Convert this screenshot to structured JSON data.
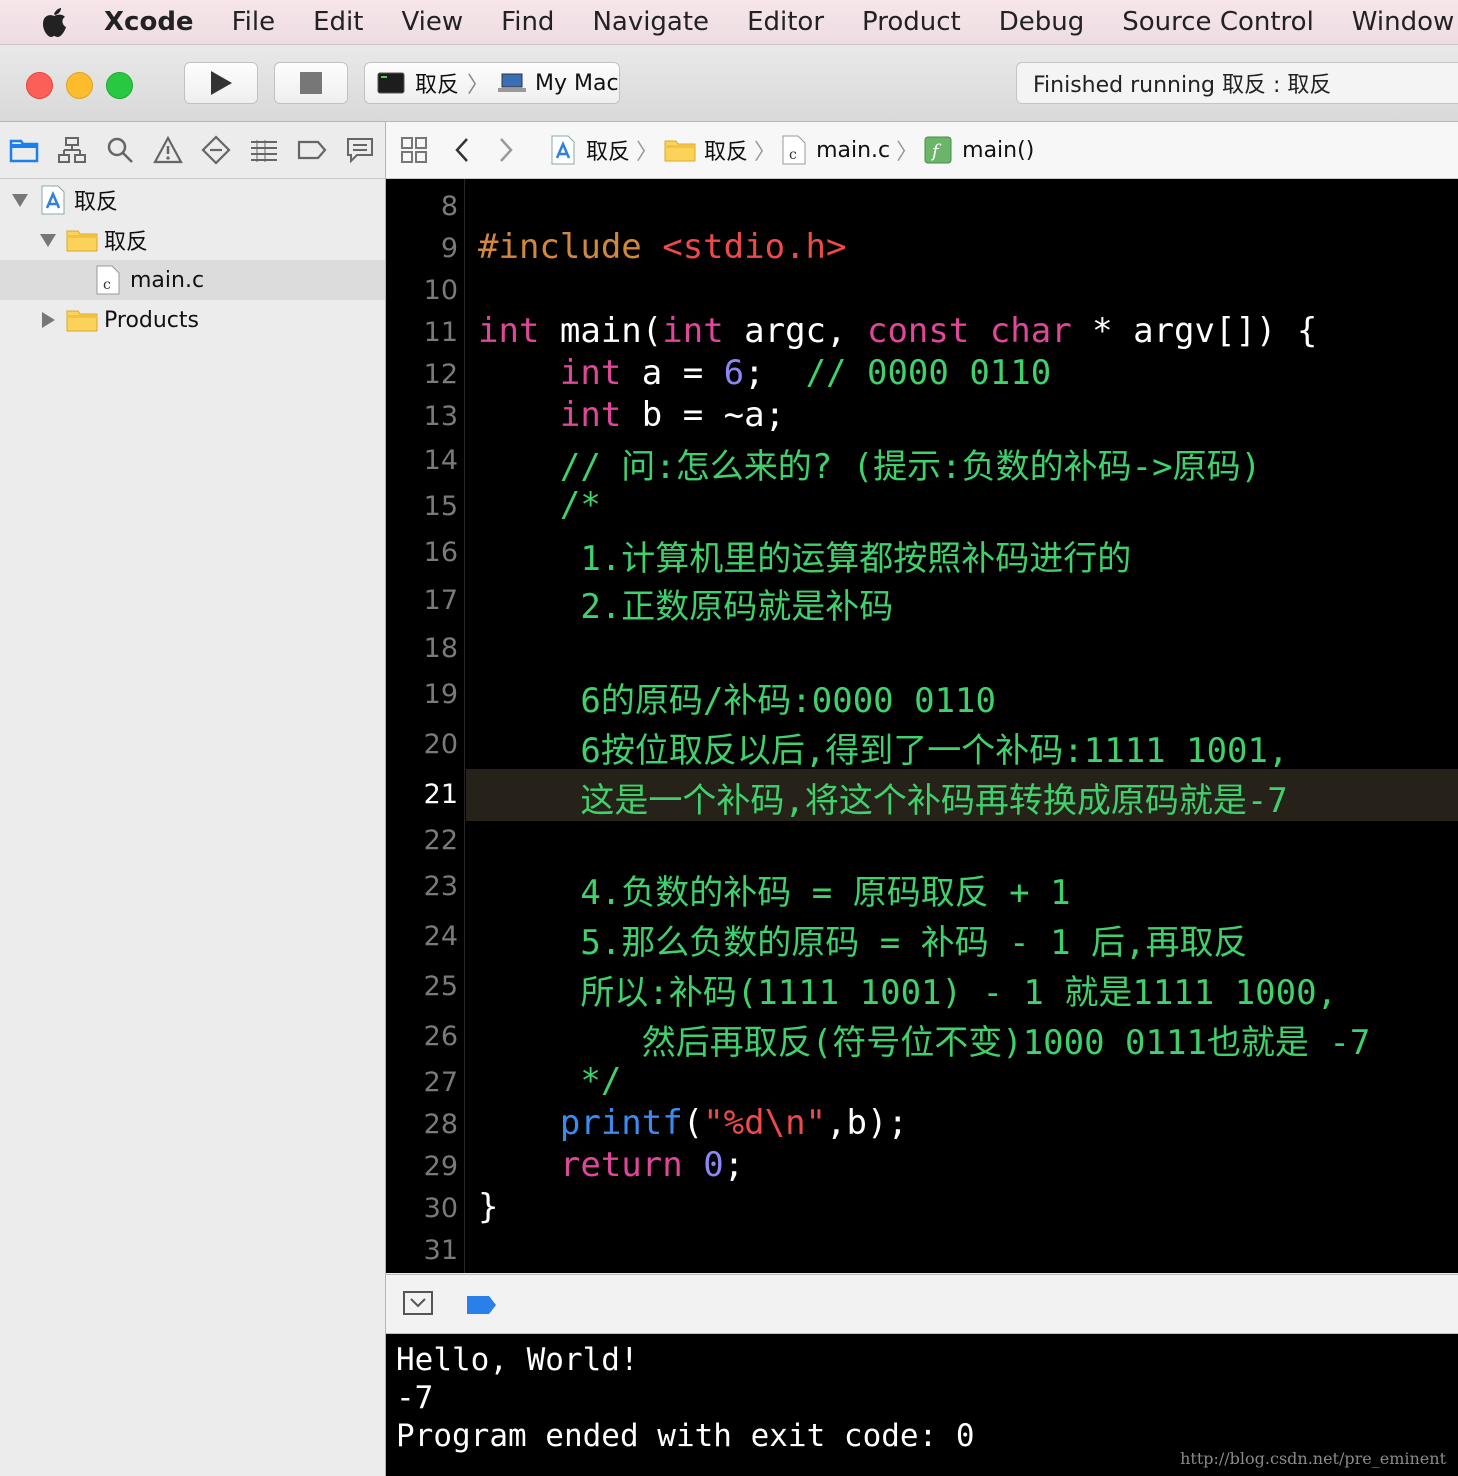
{
  "menubar": {
    "app": "Xcode",
    "items": [
      "File",
      "Edit",
      "View",
      "Find",
      "Navigate",
      "Editor",
      "Product",
      "Debug",
      "Source Control",
      "Window"
    ]
  },
  "toolbar": {
    "scheme": "取反",
    "destination": "My Mac",
    "status": "Finished running 取反 : 取反"
  },
  "navigator": {
    "items": [
      {
        "label": "取反",
        "indent": 0,
        "disclosure": "open",
        "icon": "project-icon"
      },
      {
        "label": "取反",
        "indent": 1,
        "disclosure": "open",
        "icon": "folder-icon"
      },
      {
        "label": "main.c",
        "indent": 2,
        "disclosure": "none",
        "icon": "c-file-icon",
        "selected": true
      },
      {
        "label": "Products",
        "indent": 1,
        "disclosure": "closed",
        "icon": "folder-icon"
      }
    ]
  },
  "jumpbar": {
    "crumbs": [
      {
        "label": "取反",
        "icon": "project-icon"
      },
      {
        "label": "取反",
        "icon": "folder-icon"
      },
      {
        "label": "main.c",
        "icon": "c-file-icon"
      },
      {
        "label": "main()",
        "icon": "function-icon"
      }
    ]
  },
  "editor": {
    "current_line": 21,
    "lines": [
      {
        "n": 8,
        "tokens": []
      },
      {
        "n": 9,
        "tokens": [
          [
            "pp",
            "#include "
          ],
          [
            "str",
            "<stdio.h>"
          ]
        ]
      },
      {
        "n": 10,
        "tokens": []
      },
      {
        "n": 11,
        "tokens": [
          [
            "kw",
            "int"
          ],
          [
            "pl",
            " main("
          ],
          [
            "kw",
            "int"
          ],
          [
            "pl",
            " argc, "
          ],
          [
            "kw",
            "const"
          ],
          [
            "pl",
            " "
          ],
          [
            "kw",
            "char"
          ],
          [
            "pl",
            " * argv[]) {"
          ]
        ]
      },
      {
        "n": 12,
        "tokens": [
          [
            "pl",
            "    "
          ],
          [
            "kw",
            "int"
          ],
          [
            "pl",
            " a = "
          ],
          [
            "num",
            "6"
          ],
          [
            "pl",
            ";  "
          ],
          [
            "cm",
            "// 0000 0110"
          ]
        ]
      },
      {
        "n": 13,
        "tokens": [
          [
            "pl",
            "    "
          ],
          [
            "kw",
            "int"
          ],
          [
            "pl",
            " b = ~a;"
          ]
        ]
      },
      {
        "n": 14,
        "tokens": [
          [
            "pl",
            "    "
          ],
          [
            "cm",
            "// 问:怎么来的? (提示:负数的补码->原码)"
          ]
        ]
      },
      {
        "n": 15,
        "tokens": [
          [
            "pl",
            "    "
          ],
          [
            "cm",
            "/*"
          ]
        ]
      },
      {
        "n": 16,
        "tokens": [
          [
            "pl",
            "     "
          ],
          [
            "cm",
            "1.计算机里的运算都按照补码进行的"
          ]
        ]
      },
      {
        "n": 17,
        "tokens": [
          [
            "pl",
            "     "
          ],
          [
            "cm",
            "2.正数原码就是补码"
          ]
        ]
      },
      {
        "n": 18,
        "tokens": []
      },
      {
        "n": 19,
        "tokens": [
          [
            "pl",
            "     "
          ],
          [
            "cm",
            "6的原码/补码:0000 0110"
          ]
        ]
      },
      {
        "n": 20,
        "tokens": [
          [
            "pl",
            "     "
          ],
          [
            "cm",
            "6按位取反以后,得到了一个补码:1111 1001,"
          ]
        ]
      },
      {
        "n": 21,
        "tokens": [
          [
            "pl",
            "     "
          ],
          [
            "cm",
            "这是一个补码,将这个补码再转换成原码就是-7"
          ]
        ]
      },
      {
        "n": 22,
        "tokens": []
      },
      {
        "n": 23,
        "tokens": [
          [
            "pl",
            "     "
          ],
          [
            "cm",
            "4.负数的补码 = 原码取反 + 1"
          ]
        ]
      },
      {
        "n": 24,
        "tokens": [
          [
            "pl",
            "     "
          ],
          [
            "cm",
            "5.那么负数的原码 = 补码 - 1 后,再取反"
          ]
        ]
      },
      {
        "n": 25,
        "tokens": [
          [
            "pl",
            "     "
          ],
          [
            "cm",
            "所以:补码(1111 1001) - 1 就是1111 1000,"
          ]
        ]
      },
      {
        "n": 26,
        "tokens": [
          [
            "pl",
            "        "
          ],
          [
            "cm",
            "然后再取反(符号位不变)1000 0111也就是 -7"
          ]
        ]
      },
      {
        "n": 27,
        "tokens": [
          [
            "pl",
            "     "
          ],
          [
            "cm",
            "*/"
          ]
        ]
      },
      {
        "n": 28,
        "tokens": [
          [
            "pl",
            "    "
          ],
          [
            "fn",
            "printf"
          ],
          [
            "pl",
            "("
          ],
          [
            "str",
            "\"%d\\n\""
          ],
          [
            "pl",
            ",b);"
          ]
        ]
      },
      {
        "n": 29,
        "tokens": [
          [
            "pl",
            "    "
          ],
          [
            "kw",
            "return"
          ],
          [
            "pl",
            " "
          ],
          [
            "num",
            "0"
          ],
          [
            "pl",
            ";"
          ]
        ]
      },
      {
        "n": 30,
        "tokens": [
          [
            "pl",
            "}"
          ]
        ]
      },
      {
        "n": 31,
        "tokens": []
      }
    ]
  },
  "console": {
    "lines": [
      "Hello, World!",
      "-7",
      "Program ended with exit code: 0"
    ]
  },
  "watermark": "http://blog.csdn.net/pre_eminent",
  "colors": {
    "keyword": "#e0479a",
    "preprocessor": "#d2873f",
    "string": "#ef4a4a",
    "number": "#8b87f3",
    "comment": "#3fd16b",
    "function": "#3b8cf0"
  }
}
